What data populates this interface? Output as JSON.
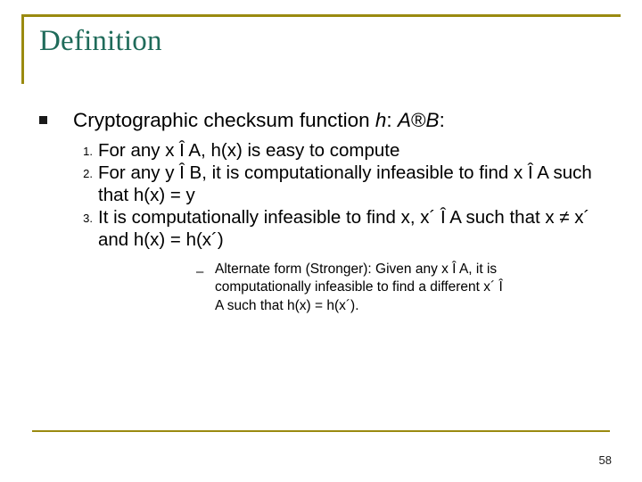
{
  "slide": {
    "title": "Definition",
    "bullet": {
      "lead": "Cryptographic checksum function ",
      "h": "h",
      "colon1": ": ",
      "A": "A",
      "arrow": "®",
      "B": "B",
      "colon2": ":"
    },
    "numbered_items": [
      {
        "num": "1.",
        "text": "For any x Î A, h(x) is easy to compute"
      },
      {
        "num": "2.",
        "text": "For any y Î B, it is computationally infeasible to find x Î A such that h(x) = y"
      },
      {
        "num": "3.",
        "text": "It is computationally infeasible to find x, x´ Î A such that x ≠ x´ and h(x) = h(x´)"
      }
    ],
    "sub_items": [
      {
        "dash": "–",
        "text": "Alternate form (Stronger): Given any x Î A, it is computationally infeasible to find a different x´ Î A such that h(x) = h(x´)."
      }
    ],
    "page_number": "58",
    "colors": {
      "title": "#1f6b5a",
      "rule": "#9a8a10",
      "text": "#000000"
    }
  }
}
